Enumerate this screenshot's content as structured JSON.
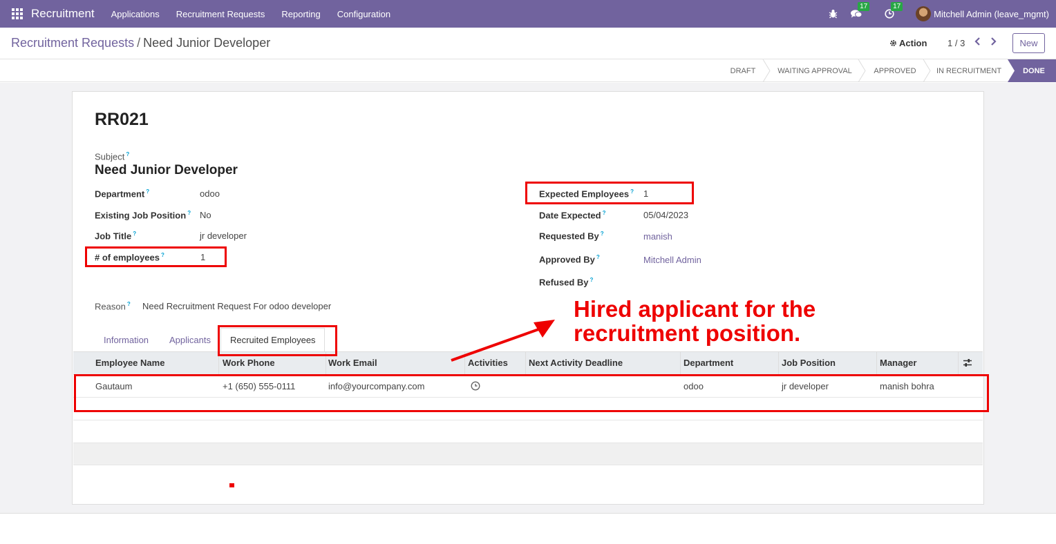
{
  "navbar": {
    "brand": "Recruitment",
    "menu": [
      "Applications",
      "Recruitment Requests",
      "Reporting",
      "Configuration"
    ],
    "messages_count": "17",
    "activities_count": "17",
    "user": "Mitchell Admin (leave_mgmt)"
  },
  "control": {
    "breadcrumb_parent": "Recruitment Requests",
    "breadcrumb_sep": "/",
    "breadcrumb_current": "Need Junior Developer",
    "action_label": "Action",
    "pager": "1 / 3",
    "new_label": "New"
  },
  "statusbar": {
    "stages": [
      "DRAFT",
      "WAITING APPROVAL",
      "APPROVED",
      "IN RECRUITMENT",
      "DONE"
    ],
    "active": "DONE"
  },
  "form": {
    "reference": "RR021",
    "subject_label": "Subject",
    "subject": "Need Junior Developer",
    "department_label": "Department",
    "department": "odoo",
    "existing_job_label": "Existing Job Position",
    "existing_job": "No",
    "job_title_label": "Job Title",
    "job_title": "jr developer",
    "num_employees_label": "# of employees",
    "num_employees": "1",
    "expected_employees_label": "Expected Employees",
    "expected_employees": "1",
    "date_expected_label": "Date Expected",
    "date_expected": "05/04/2023",
    "requested_by_label": "Requested By",
    "requested_by": "manish",
    "approved_by_label": "Approved By",
    "approved_by": "Mitchell Admin",
    "refused_by_label": "Refused By",
    "refused_by": "",
    "reason_label": "Reason",
    "reason": "Need Recruitment Request For odoo developer",
    "help_mark": "?"
  },
  "tabs": [
    "Information",
    "Applicants",
    "Recruited Employees"
  ],
  "table": {
    "columns": [
      "Employee Name",
      "Work Phone",
      "Work Email",
      "Activities",
      "Next Activity Deadline",
      "Department",
      "Job Position",
      "Manager"
    ],
    "rows": [
      {
        "employee_name": "Gautaum",
        "work_phone": "+1 (650) 555-0111",
        "work_email": "info@yourcompany.com",
        "activities": "clock-icon",
        "next_deadline": "",
        "department": "odoo",
        "job_position": "jr developer",
        "manager": "manish bohra"
      }
    ]
  },
  "annotation": {
    "line1": "Hired applicant for the",
    "line2": "recruitment position.",
    "color": "#ee0000"
  },
  "colors": {
    "brand": "#71639e",
    "badge": "#28a745"
  }
}
